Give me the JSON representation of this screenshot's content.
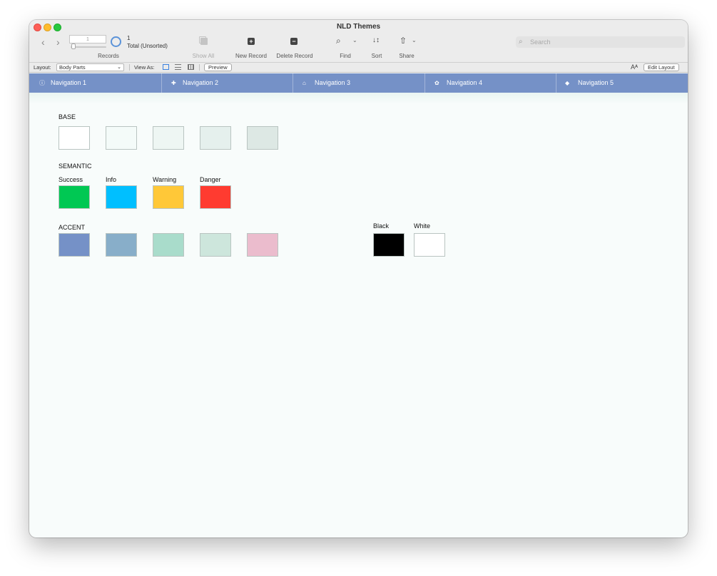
{
  "window": {
    "title": "NLD Themes"
  },
  "toolbar": {
    "record_number": "1",
    "record_count": "1",
    "record_total": "Total (Unsorted)",
    "records_label": "Records",
    "show_all_label": "Show All",
    "new_record_label": "New Record",
    "delete_record_label": "Delete Record",
    "find_label": "Find",
    "sort_label": "Sort",
    "share_label": "Share",
    "search_placeholder": "Search"
  },
  "layout_bar": {
    "layout_label": "Layout:",
    "layout_value": "Body Parts",
    "view_as_label": "View As:",
    "preview_label": "Preview",
    "edit_layout_label": "Edit Layout"
  },
  "navigation": [
    {
      "label": "Navigation 1",
      "icon": "info-icon"
    },
    {
      "label": "Navigation 2",
      "icon": "plus-icon"
    },
    {
      "label": "Navigation 3",
      "icon": "home-icon"
    },
    {
      "label": "Navigation 4",
      "icon": "gear-icon"
    },
    {
      "label": "Navigation 5",
      "icon": "cube-icon"
    }
  ],
  "palette": {
    "base": {
      "title": "BASE",
      "colors": [
        "#ffffff",
        "#f4fbf9",
        "#eef6f3",
        "#e5f0ed",
        "#dde8e4"
      ]
    },
    "semantic": {
      "title": "SEMANTIC",
      "items": [
        {
          "label": "Success",
          "color": "#00c853"
        },
        {
          "label": "Info",
          "color": "#00bfff"
        },
        {
          "label": "Warning",
          "color": "#ffc838"
        },
        {
          "label": "Danger",
          "color": "#ff3b30"
        }
      ]
    },
    "accent": {
      "title": "ACCENT",
      "colors": [
        "#7591c7",
        "#88aec9",
        "#a9dccb",
        "#cde6dc",
        "#ebbccd"
      ]
    },
    "mono": [
      {
        "label": "Black",
        "color": "#000000"
      },
      {
        "label": "White",
        "color": "#ffffff"
      }
    ]
  }
}
